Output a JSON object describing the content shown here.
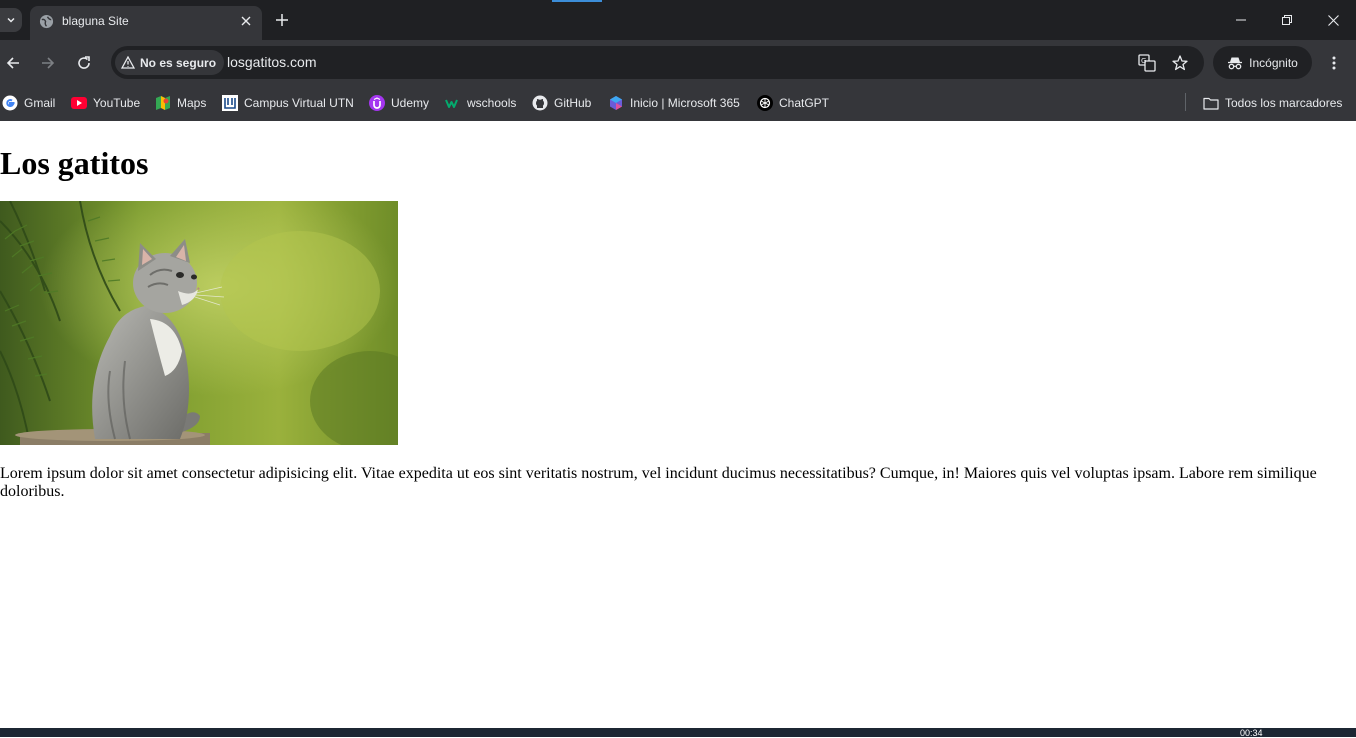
{
  "tab": {
    "title": "blaguna Site"
  },
  "address_bar": {
    "security_label": "No es seguro",
    "url": "losgatitos.com"
  },
  "profile": {
    "label": "Incógnito"
  },
  "bookmarks": {
    "items": [
      {
        "label": "Gmail",
        "icon": "google-icon"
      },
      {
        "label": "YouTube",
        "icon": "youtube-icon"
      },
      {
        "label": "Maps",
        "icon": "maps-icon"
      },
      {
        "label": "Campus Virtual UTN",
        "icon": "utn-icon"
      },
      {
        "label": "Udemy",
        "icon": "udemy-icon"
      },
      {
        "label": "wschools",
        "icon": "w3schools-icon"
      },
      {
        "label": "GitHub",
        "icon": "github-icon"
      },
      {
        "label": "Inicio | Microsoft 365",
        "icon": "microsoft365-icon"
      },
      {
        "label": "ChatGPT",
        "icon": "chatgpt-icon"
      }
    ],
    "all_bookmarks": "Todos los marcadores"
  },
  "page": {
    "heading": "Los gatitos",
    "image_description": "kitten",
    "paragraph": "Lorem ipsum dolor sit amet consectetur adipisicing elit. Vitae expedita ut eos sint veritatis nostrum, vel incidunt ducimus necessitatibus? Cumque, in! Maiores quis vel voluptas ipsam. Labore rem similique doloribus."
  },
  "taskbar": {
    "clock": "00:34"
  },
  "colors": {
    "tabbar_bg": "#1f2023",
    "toolbar_bg": "#35363a",
    "omnibox_bg": "#202124",
    "text_light": "#e8eaed",
    "accent": "#3c8dd8"
  }
}
